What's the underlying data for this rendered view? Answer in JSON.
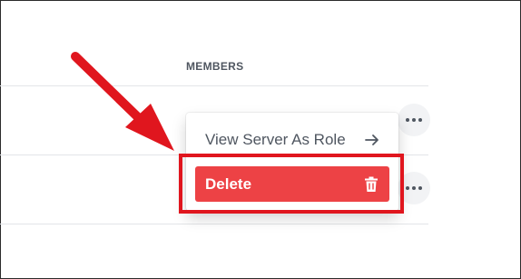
{
  "table": {
    "members_header": "MEMBERS"
  },
  "context_menu": {
    "view_server_as_role_label": "View Server As Role",
    "delete_label": "Delete"
  },
  "icons": {
    "more": "more-horizontal-icon",
    "arrow_right": "arrow-right-icon",
    "trash": "trash-icon"
  },
  "colors": {
    "delete_bg": "#ed4245",
    "annotation_red": "#e0161e",
    "header_text": "#4f5660"
  }
}
